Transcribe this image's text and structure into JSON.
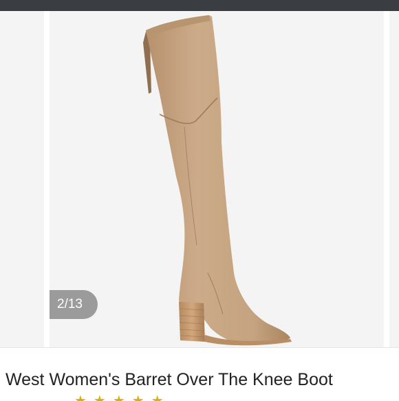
{
  "colors": {
    "top_bar": "#3a3d42",
    "slide_background": "#f4f4f4",
    "boot_suede": "#c9a886",
    "heel_wood": "#c79c73",
    "counter_pill": "#787878",
    "rating_star": "#d7b400"
  },
  "carousel": {
    "counter": "2/13",
    "current_index": 2,
    "total": 13,
    "image_subject": "over-the-knee-boot"
  },
  "product": {
    "title": "West Women's Barret Over The Knee Boot",
    "rating_stars": "★★★★★"
  }
}
